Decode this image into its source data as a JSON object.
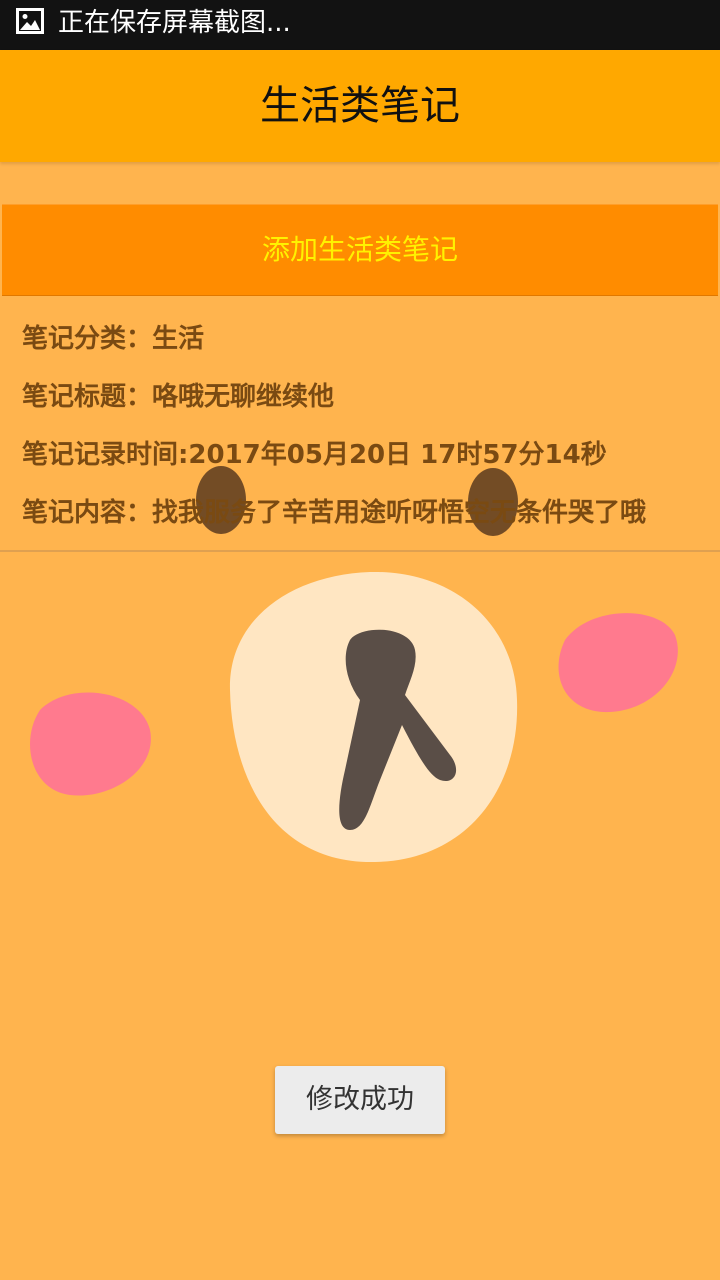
{
  "status_bar": {
    "notification_icon": "image-icon",
    "text": "正在保存屏幕截图..."
  },
  "app_bar": {
    "title": "生活类笔记"
  },
  "add_button": {
    "label": "添加生活类笔记"
  },
  "note": {
    "category_label": "笔记分类：",
    "category_value": "生活",
    "title_label": "笔记标题：",
    "title_value": "咯哦无聊继续他",
    "time_label": "笔记记录时间:",
    "time_value": "2017年05月20日 17时57分14秒",
    "content_label": "笔记内容：",
    "content_value": "找我服务了辛苦用途听呀悟空无条件哭了哦"
  },
  "toast": {
    "message": "修改成功"
  },
  "colors": {
    "status_bar": "#121212",
    "app_bar": "#FFA800",
    "background": "#FFB44E",
    "add_button": "#FF8C00",
    "add_button_text": "#FFF200",
    "note_text": "#7A4A12",
    "toast_bg": "#ECECEC"
  }
}
